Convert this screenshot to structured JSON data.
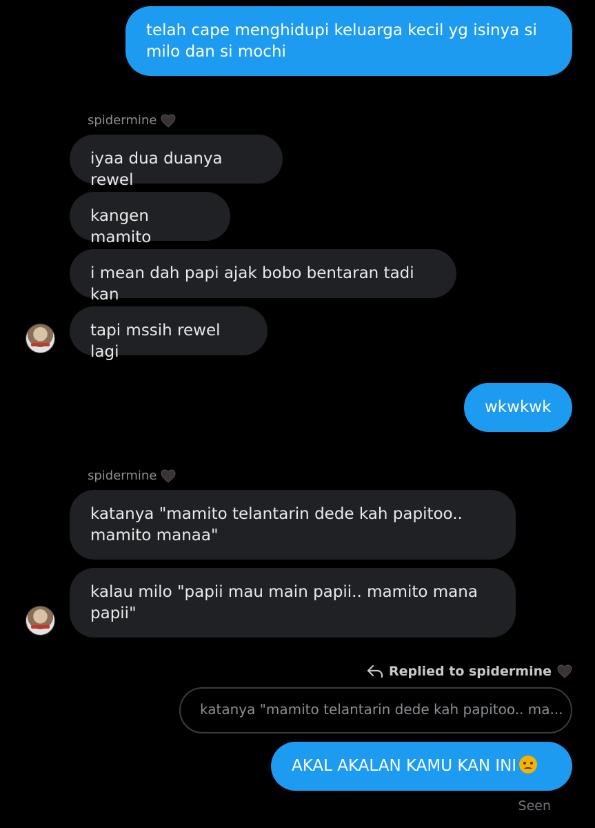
{
  "messages": [
    {
      "id": "m1",
      "from": "me",
      "text": "telah cape menghidupi keluarga kecil yg isinya si milo dan si mochi"
    },
    {
      "id": "m2",
      "from": "them",
      "text": "iyaa dua duanya rewel"
    },
    {
      "id": "m3",
      "from": "them",
      "text": "kangen mamito"
    },
    {
      "id": "m4",
      "from": "them",
      "text": "i mean dah papi ajak bobo bentaran tadi kan"
    },
    {
      "id": "m5",
      "from": "them",
      "text": "tapi mssih rewel lagi"
    },
    {
      "id": "m6",
      "from": "me",
      "text": "wkwkwk"
    },
    {
      "id": "m7",
      "from": "them",
      "text": "katanya \"mamito telantarin dede kah papitoo.. mamito manaa\""
    },
    {
      "id": "m8",
      "from": "them",
      "text": "kalau milo \"papii mau main papii.. mamito mana papii\""
    },
    {
      "id": "m9",
      "from": "me",
      "text": "AKAL AKALAN KAMU KAN INI"
    }
  ],
  "sender_name": "spidermine",
  "heart_icon": "black-heart-icon",
  "reply": {
    "label": "Replied to spidermine",
    "quote": "katanya \"mamito telantarin dede kah papitoo.. ma..."
  },
  "emoji_icon": "angry-face-icon",
  "seen": "Seen",
  "colors": {
    "outgoing": "#1d9bf0",
    "incoming": "#202124",
    "background": "#000000"
  }
}
